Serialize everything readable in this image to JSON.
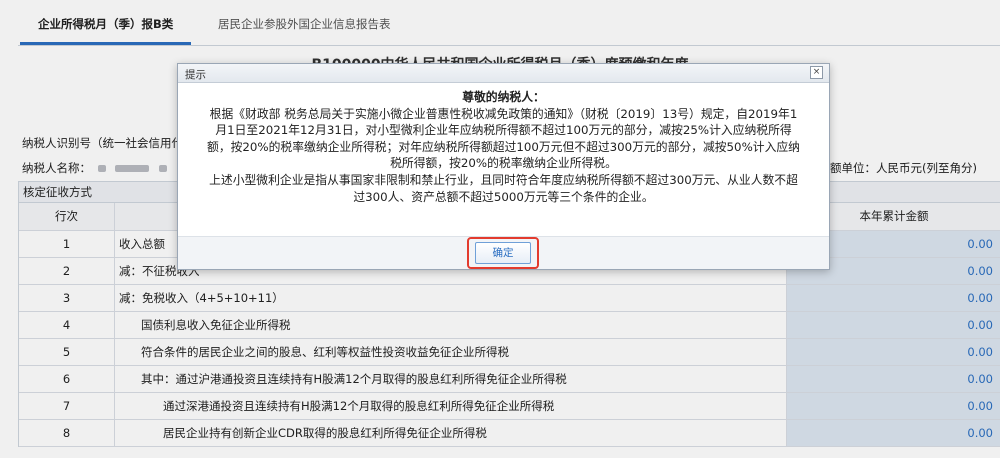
{
  "tabs": {
    "active": "企业所得税月（季）报B类",
    "second": "居民企业参股外国企业信息报告表"
  },
  "doc_title": "B100000中华人民共和国企业所得税月（季）度预缴和年度",
  "taxpayer": {
    "id_label": "纳税人识别号（统一社会信用代",
    "name_label": "纳税人名称：",
    "amount_unit": "额单位：人民币元(列至角分)"
  },
  "table": {
    "section": "核定征收方式",
    "col_row": "行次",
    "col_amount": "本年累计金额",
    "rows": [
      {
        "num": "1",
        "name": "收入总额",
        "value": "0.00",
        "indent": 0
      },
      {
        "num": "2",
        "name": "减：不征税收入",
        "value": "0.00",
        "indent": 0
      },
      {
        "num": "3",
        "name": "减：免税收入（4+5+10+11）",
        "value": "0.00",
        "indent": 0
      },
      {
        "num": "4",
        "name": "国债利息收入免征企业所得税",
        "value": "0.00",
        "indent": 1
      },
      {
        "num": "5",
        "name": "符合条件的居民企业之间的股息、红利等权益性投资收益免征企业所得税",
        "value": "0.00",
        "indent": 1
      },
      {
        "num": "6",
        "name": "其中：通过沪港通投资且连续持有H股满12个月取得的股息红利所得免征企业所得税",
        "value": "0.00",
        "indent": 1
      },
      {
        "num": "7",
        "name": "通过深港通投资且连续持有H股满12个月取得的股息红利所得免征企业所得税",
        "value": "0.00",
        "indent": 2
      },
      {
        "num": "8",
        "name": "居民企业持有创新企业CDR取得的股息红利所得免征企业所得税",
        "value": "0.00",
        "indent": 2
      }
    ]
  },
  "dialog": {
    "title": "提示",
    "close_glyph": "×",
    "greeting": "尊敬的纳税人：",
    "para1": "根据《财政部 税务总局关于实施小微企业普惠性税收减免政策的通知》（财税〔2019〕13号）规定，自2019年1月1日至2021年12月31日，对小型微利企业年应纳税所得额不超过100万元的部分，减按25%计入应纳税所得额，按20%的税率缴纳企业所得税；对年应纳税所得额超过100万元但不超过300万元的部分，减按50%计入应纳税所得额，按20%的税率缴纳企业所得税。",
    "para2": "上述小型微利企业是指从事国家非限制和禁止行业，且同时符合年度应纳税所得额不超过300万元、从业人数不超过300人、资产总额不超过5000万元等三个条件的企业。",
    "ok_label": "确定"
  }
}
